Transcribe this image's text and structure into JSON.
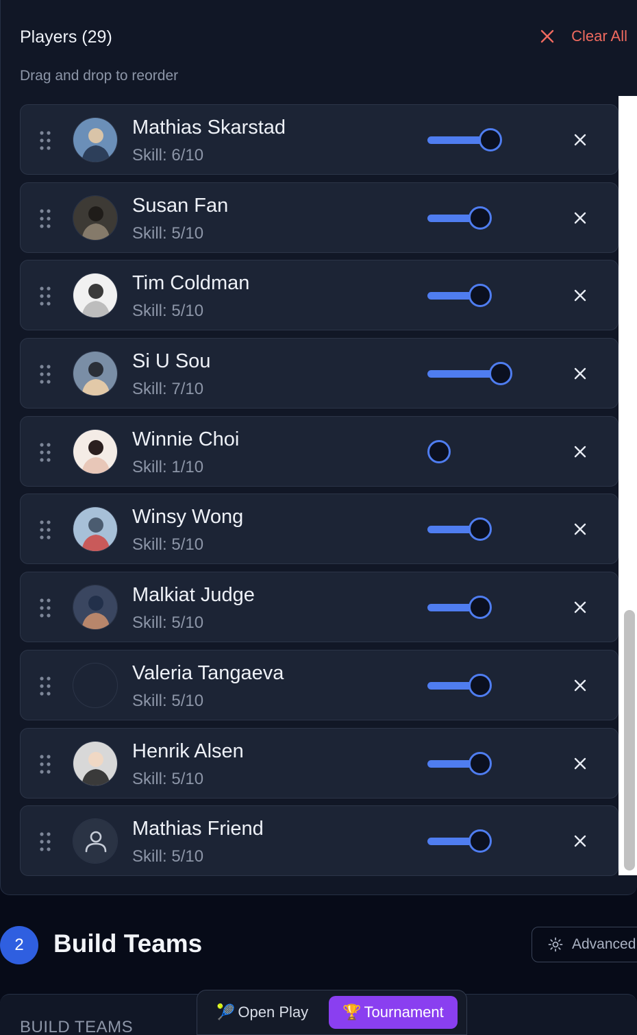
{
  "players_section": {
    "title": "Players (29)",
    "clear_all": "Clear All",
    "subtitle": "Drag and drop to reorder"
  },
  "players": [
    {
      "name": "Mathias Skarstad",
      "skill": "Skill: 6/10",
      "skill_value": 6,
      "avatar": "photo"
    },
    {
      "name": "Susan Fan",
      "skill": "Skill: 5/10",
      "skill_value": 5,
      "avatar": "photo"
    },
    {
      "name": "Tim Coldman",
      "skill": "Skill: 5/10",
      "skill_value": 5,
      "avatar": "photo"
    },
    {
      "name": "Si U Sou",
      "skill": "Skill: 7/10",
      "skill_value": 7,
      "avatar": "photo"
    },
    {
      "name": "Winnie Choi",
      "skill": "Skill: 1/10",
      "skill_value": 1,
      "avatar": "photo"
    },
    {
      "name": "Winsy Wong",
      "skill": "Skill: 5/10",
      "skill_value": 5,
      "avatar": "photo"
    },
    {
      "name": "Malkiat Judge",
      "skill": "Skill: 5/10",
      "skill_value": 5,
      "avatar": "photo"
    },
    {
      "name": "Valeria Tangaeva",
      "skill": "Skill: 5/10",
      "skill_value": 5,
      "avatar": "empty"
    },
    {
      "name": "Henrik Alsen",
      "skill": "Skill: 5/10",
      "skill_value": 5,
      "avatar": "photo"
    },
    {
      "name": "Mathias Friend",
      "skill": "Skill: 5/10",
      "skill_value": 5,
      "avatar": "user-icon"
    }
  ],
  "build_teams": {
    "step": "2",
    "title": "Build Teams",
    "advanced_label": "Advanced",
    "card_label": "BUILD TEAMS"
  },
  "mode_switch": {
    "open_play": {
      "emoji": "🎾",
      "label": "Open Play"
    },
    "tournament": {
      "emoji": "🏆",
      "label": "Tournament"
    },
    "active": "tournament"
  },
  "colors": {
    "accent": "#4f7df0",
    "danger": "#f06a5f",
    "tournament": "#8a3ff0",
    "card": "#1c2435"
  },
  "icons": {
    "drag": "drag-handle-icon",
    "remove": "close-icon",
    "advanced": "gear-icon",
    "user_placeholder": "user-icon"
  }
}
